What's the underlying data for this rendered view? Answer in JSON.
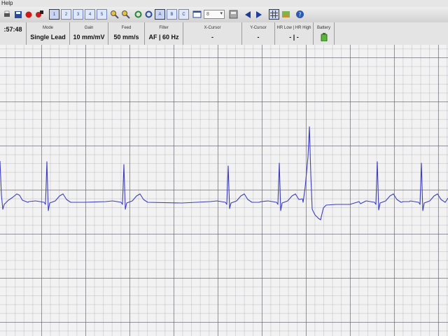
{
  "menu": {
    "help": "Help"
  },
  "toolbar": {
    "layout_buttons": [
      "1",
      "2",
      "3",
      "4",
      "5"
    ],
    "zoom_buttons": [
      "A",
      "B",
      "C"
    ],
    "selector_value": "8"
  },
  "status": {
    "time": {
      "label": "",
      "value": ":57:48"
    },
    "mode": {
      "label": "Mode",
      "value": "Single Lead"
    },
    "gain": {
      "label": "Gain",
      "value": "10 mm/mV"
    },
    "feed": {
      "label": "Feed",
      "value": "50 mm/s"
    },
    "filter": {
      "label": "Filter",
      "value": "AF | 60 Hz"
    },
    "x_cursor": {
      "label": "X-Cursor",
      "value": "-"
    },
    "y_cursor": {
      "label": "Y-Cursor",
      "value": "-"
    },
    "hr": {
      "label": "HR Low | HR High",
      "value": "- | -"
    },
    "battery": {
      "label": "Battery"
    }
  },
  "colors": {
    "trace": "#3d3dc2",
    "grid_major": "#5a5a64",
    "grid_minor": "#8c8c96",
    "background": "#f2f2f3"
  }
}
